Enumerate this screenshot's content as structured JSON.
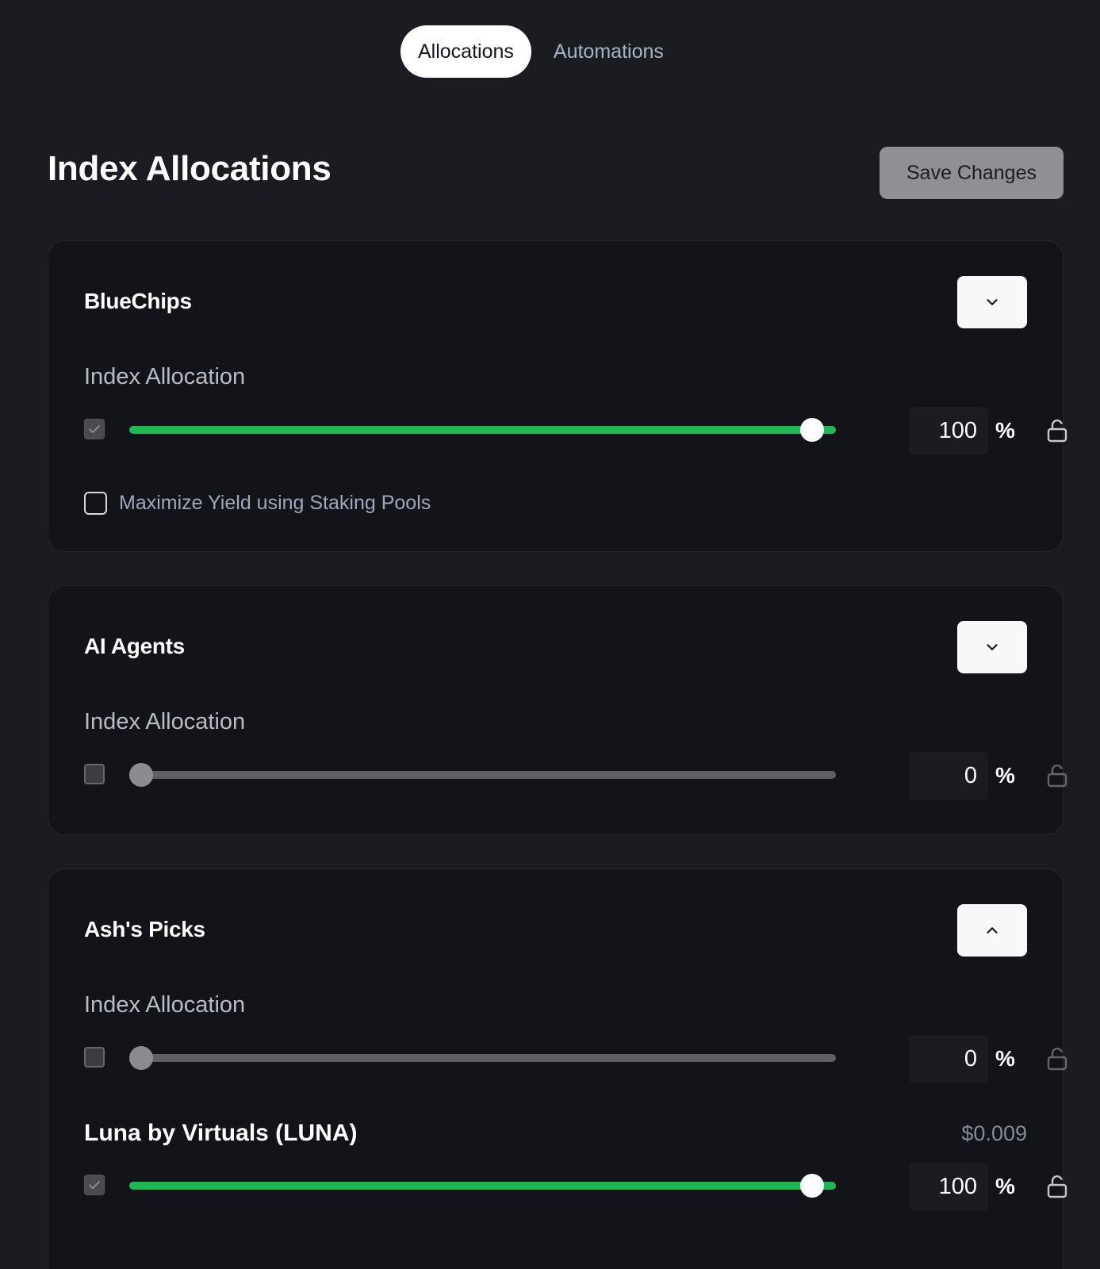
{
  "tabs": [
    {
      "label": "Allocations",
      "active": true
    },
    {
      "label": "Automations",
      "active": false
    }
  ],
  "header": {
    "title": "Index Allocations",
    "save_label": "Save Changes"
  },
  "cards": [
    {
      "title": "BlueChips",
      "expanded": false,
      "index_label": "Index Allocation",
      "allocation": {
        "value": "100",
        "percent_sign": "%",
        "checked": true,
        "locked": false
      },
      "yield_label": "Maximize Yield using Staking Pools",
      "yield_checked": false
    },
    {
      "title": "AI Agents",
      "expanded": false,
      "index_label": "Index Allocation",
      "allocation": {
        "value": "0",
        "percent_sign": "%",
        "checked": false,
        "locked": false
      }
    },
    {
      "title": "Ash's Picks",
      "expanded": true,
      "index_label": "Index Allocation",
      "allocation": {
        "value": "0",
        "percent_sign": "%",
        "checked": false,
        "locked": false
      },
      "coins": [
        {
          "name": "Luna by Virtuals (LUNA)",
          "price": "$0.009",
          "allocation": {
            "value": "100",
            "percent_sign": "%",
            "checked": true,
            "locked": false
          }
        }
      ]
    }
  ],
  "colors": {
    "background": "#1b1c21",
    "card": "#131419",
    "accent_green": "#1fb954",
    "track": "#5e6065"
  },
  "icons": {
    "collapsed": "chevron-down-icon",
    "expanded": "chevron-up-icon",
    "lock": "unlock-icon",
    "check": "check-icon"
  }
}
